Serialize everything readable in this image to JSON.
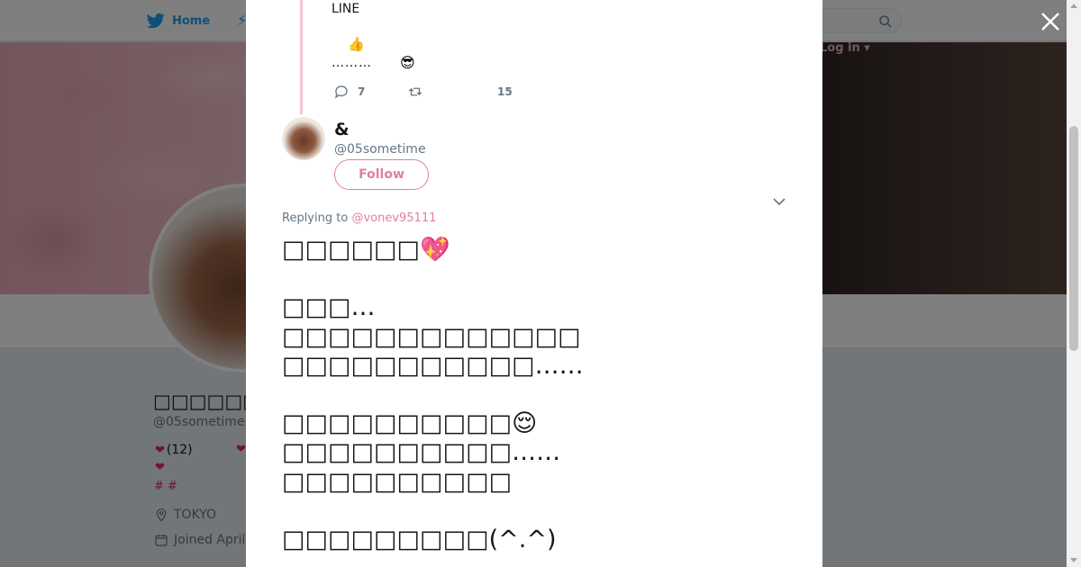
{
  "topbar": {
    "home_label": "Home",
    "login_label": "Log in ▾"
  },
  "profile": {
    "name": "□□□□□□□□□□",
    "handle": "@05sometime",
    "bio_heart": "❤",
    "bio_count": "(12)",
    "bio_heart2": "❤",
    "bio_heart3": "❤",
    "hashtags": "# #",
    "location": "TOKYO",
    "joined": "Joined April"
  },
  "parent_tweet": {
    "line1": "LINE",
    "emoji_thumb": "👍",
    "dots": "………",
    "emoji_cool": "😎",
    "reply_count": "7",
    "like_count": "15"
  },
  "tweet": {
    "display_name": "&",
    "screen_name": "@05sometime",
    "follow_label": "Follow",
    "replying_prefix": "Replying to ",
    "replying_handle": "@vonev95111",
    "text": "□□□□□□💖\n\n□□□…\n□□□□□□□□□□□□□\n□□□□□□□□□□□……\n\n□□□□□□□□□□😌\n□□□□□□□□□□……\n□□□□□□□□□□\n\n□□□□□□□□□(^.^)"
  },
  "colors": {
    "accent": "#e0809e",
    "twitter_blue": "#1da1f2",
    "thread_line": "#f4c4d2"
  },
  "icons": [
    "twitter-bird-icon",
    "search-icon",
    "close-icon",
    "reply-icon",
    "retweet-icon",
    "chevron-down-icon",
    "location-pin-icon",
    "calendar-icon"
  ]
}
